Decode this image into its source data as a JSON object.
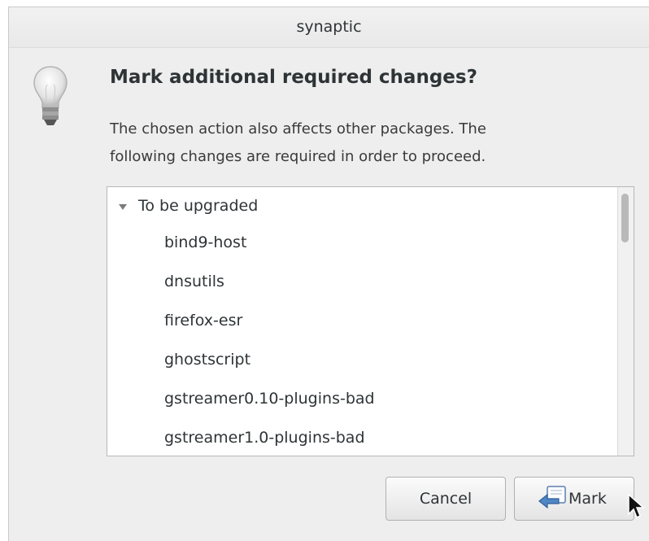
{
  "window": {
    "title": "synaptic"
  },
  "dialog": {
    "heading": "Mark additional required changes?",
    "description_lines": [
      "The chosen action also affects other packages. The",
      "following changes are required in order to proceed."
    ],
    "icon": "lightbulb-icon"
  },
  "changes": {
    "group_label": "To be upgraded",
    "group_expanded": true,
    "packages": [
      "bind9-host",
      "dnsutils",
      "firefox-esr",
      "ghostscript",
      "gstreamer0.10-plugins-bad",
      "gstreamer1.0-plugins-bad"
    ]
  },
  "buttons": {
    "cancel_label": "Cancel",
    "mark_label": "Mark",
    "mark_icon": "mark-arrow-icon"
  },
  "colors": {
    "window_bg": "#eeeeee",
    "text": "#2e3436",
    "list_bg": "#ffffff"
  }
}
